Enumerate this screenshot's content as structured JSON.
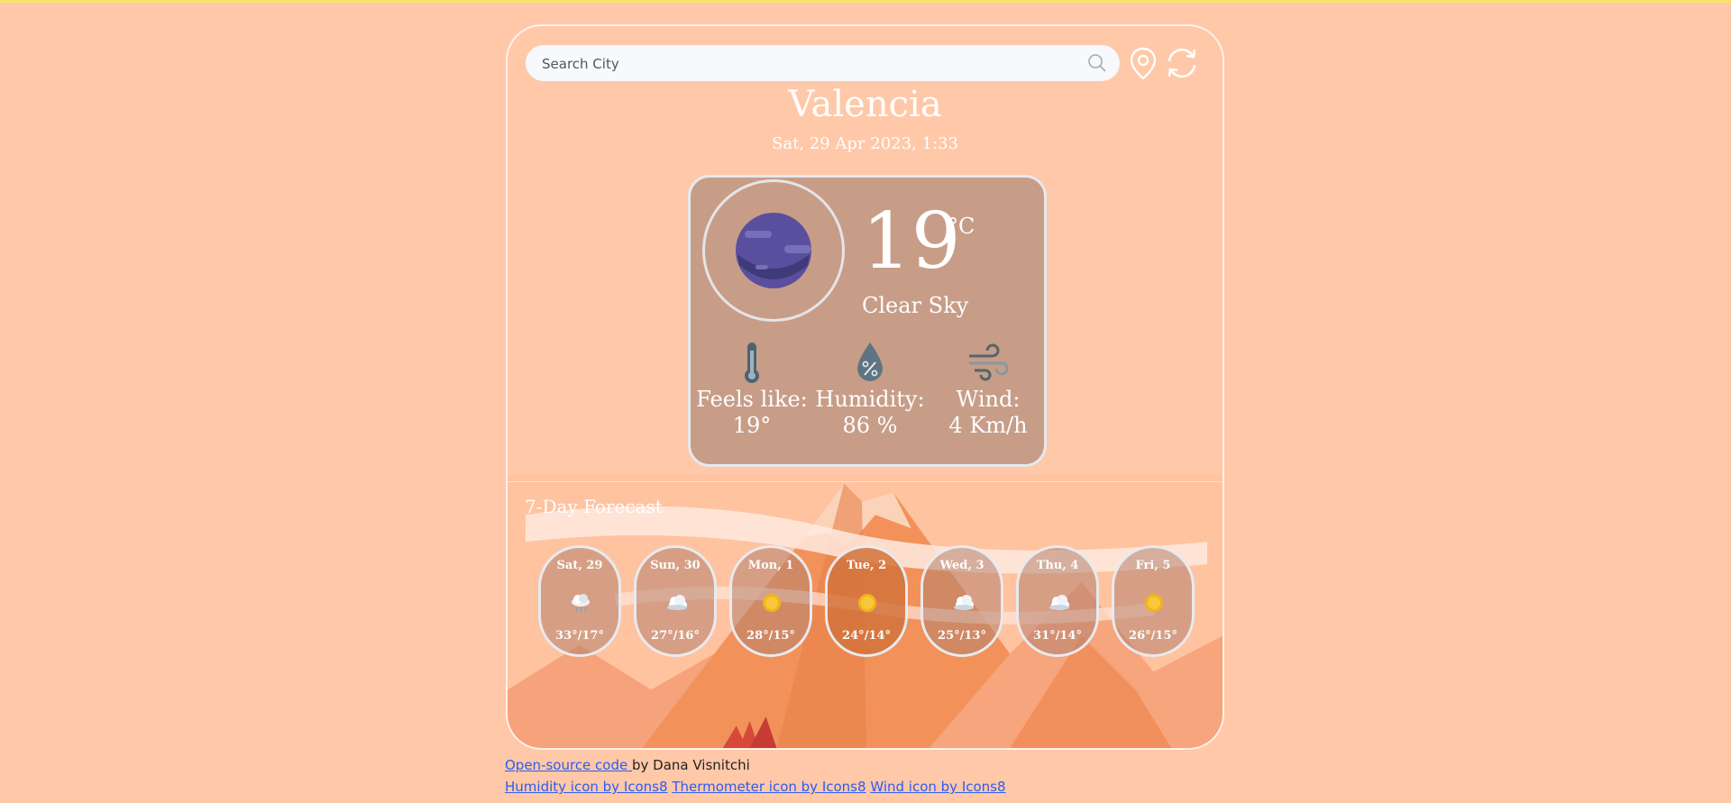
{
  "search": {
    "placeholder": "Search City",
    "value": ""
  },
  "toolbar": {
    "location_icon": "map-pin-icon",
    "refresh_icon": "refresh-icon"
  },
  "location": {
    "city": "Valencia",
    "datetime": "Sat, 29 Apr 2023, 1:33"
  },
  "current": {
    "temperature": "19",
    "unit": "°C",
    "condition": "Clear Sky",
    "icon": "moon-icon",
    "stats": [
      {
        "label": "Feels like:",
        "value": "19°",
        "icon": "thermometer-icon"
      },
      {
        "label": "Humidity:",
        "value": "86 %",
        "icon": "humidity-drop-icon"
      },
      {
        "label": "Wind:",
        "value": "4 Km/h",
        "icon": "wind-icon"
      }
    ]
  },
  "forecast": {
    "title": "7-Day Forecast",
    "days": [
      {
        "name": "Sat, 29",
        "range": "33°/17°",
        "icon": "rain-cloud-icon",
        "active": false
      },
      {
        "name": "Sun, 30",
        "range": "27°/16°",
        "icon": "cloud-icon",
        "active": false
      },
      {
        "name": "Mon, 1",
        "range": "28°/15°",
        "icon": "sun-icon",
        "active": false
      },
      {
        "name": "Tue, 2",
        "range": "24°/14°",
        "icon": "sun-icon",
        "active": true
      },
      {
        "name": "Wed, 3",
        "range": "25°/13°",
        "icon": "cloud-icon",
        "active": false
      },
      {
        "name": "Thu, 4",
        "range": "31°/14°",
        "icon": "cloud-icon",
        "active": false
      },
      {
        "name": "Fri, 5",
        "range": "26°/15°",
        "icon": "sun-icon",
        "active": false
      }
    ]
  },
  "footer": {
    "source_link": "Open-source code ",
    "author": "by Dana Visnitchi",
    "credits": [
      "Humidity icon by Icons8",
      "Thermometer icon by Icons8",
      "Wind icon by Icons8"
    ]
  },
  "colors": {
    "background": "#ffc8a8",
    "card": "#c79d88",
    "active_day": "#d2733c",
    "link": "#2b5cf0"
  }
}
